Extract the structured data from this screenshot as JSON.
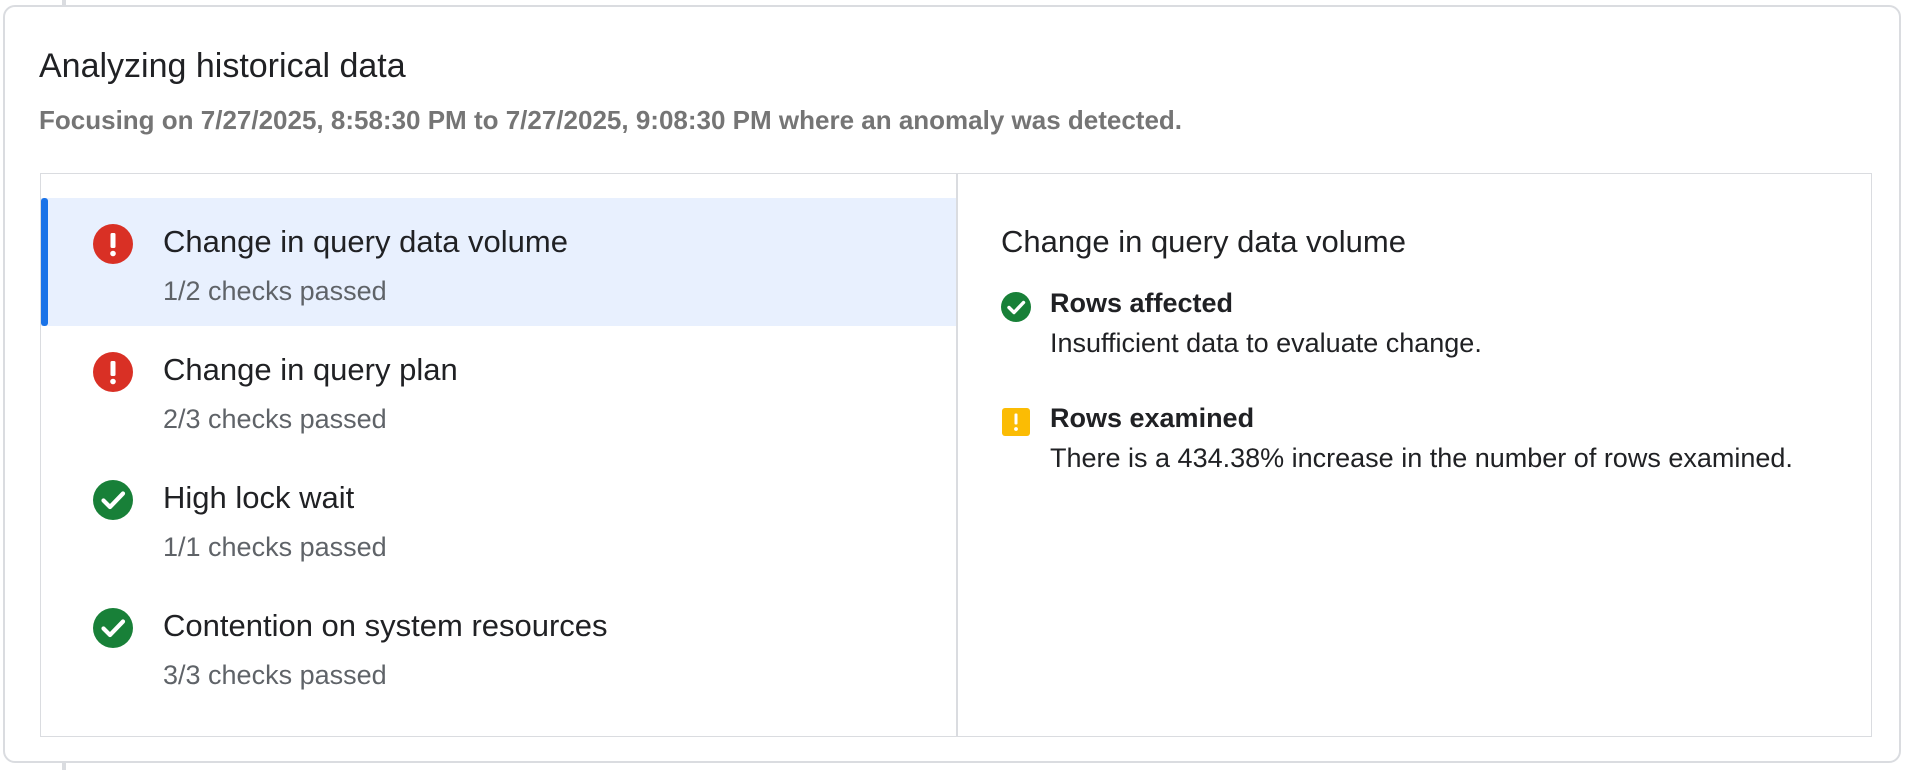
{
  "card": {
    "title": "Analyzing historical data",
    "subtitle": "Focusing on 7/27/2025, 8:58:30 PM to 7/27/2025, 9:08:30 PM where an anomaly was detected."
  },
  "colors": {
    "error": "#d93025",
    "success": "#188038",
    "warning": "#fbbc04",
    "selected_bg": "#e8f0fe",
    "accent": "#1a73e8"
  },
  "list": {
    "items": [
      {
        "title": "Change in query data volume",
        "subtitle": "1/2 checks passed",
        "status_icon": "error-icon",
        "selected": true
      },
      {
        "title": "Change in query plan",
        "subtitle": "2/3 checks passed",
        "status_icon": "error-icon",
        "selected": false
      },
      {
        "title": "High lock wait",
        "subtitle": "1/1 checks passed",
        "status_icon": "check-circle-icon",
        "selected": false
      },
      {
        "title": "Contention on system resources",
        "subtitle": "3/3 checks passed",
        "status_icon": "check-circle-icon",
        "selected": false
      }
    ]
  },
  "detail": {
    "title": "Change in query data volume",
    "checks": [
      {
        "title": "Rows affected",
        "description": "Insufficient data to evaluate change.",
        "status_icon": "check-circle-icon"
      },
      {
        "title": "Rows examined",
        "description": "There is a 434.38% increase in the number of rows examined.",
        "status_icon": "warning-icon"
      }
    ]
  }
}
